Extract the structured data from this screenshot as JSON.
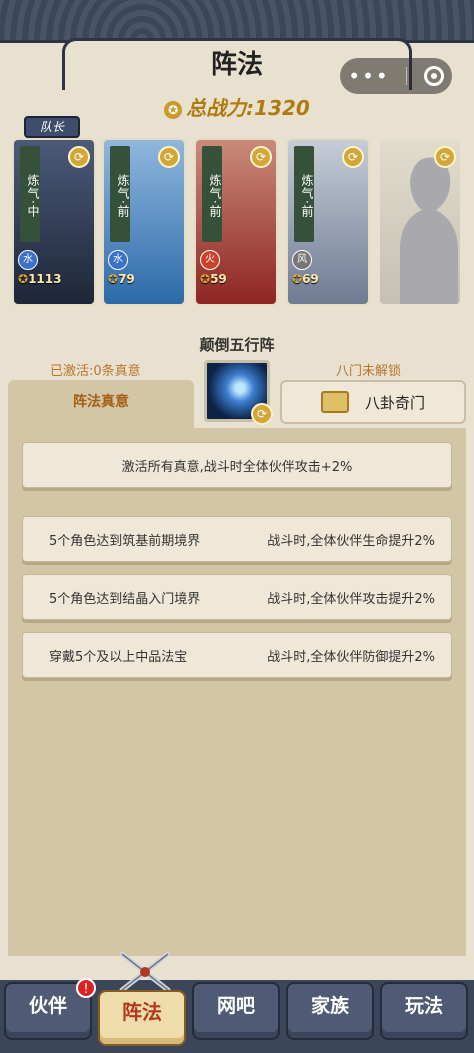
{
  "header": {
    "title": "阵法"
  },
  "total_power": {
    "label": "总战力:1320"
  },
  "captain_tag": "队长",
  "cards": [
    {
      "realm": "炼气·中",
      "element": "水",
      "element_color": "#3b72c8",
      "power": "1113",
      "bg": "#2e3a52"
    },
    {
      "realm": "炼气·前",
      "element": "水",
      "element_color": "#3b72c8",
      "power": "79",
      "bg": "#3a7bbf"
    },
    {
      "realm": "炼气·前",
      "element": "火",
      "element_color": "#c9432b",
      "power": "59",
      "bg": "#a9312e"
    },
    {
      "realm": "炼气·前",
      "element": "风",
      "element_color": "#777777",
      "power": "69",
      "bg": "#7f8aa0"
    },
    {
      "realm": "",
      "element": "",
      "element_color": "",
      "power": "",
      "bg": "#d4ccba",
      "locked": true
    }
  ],
  "formation": {
    "name": "颠倒五行阵",
    "activated_text": "已激活:0条真意",
    "bamen_text": "八门未解锁",
    "tab_label": "阵法真意",
    "bagua_label": "八卦奇门"
  },
  "effects": {
    "all": "激活所有真意,战斗时全体伙伴攻击+2%",
    "rows": [
      {
        "condition": "5个角色达到筑基前期境界",
        "effect": "战斗时,全体伙伴生命提升2%"
      },
      {
        "condition": "5个角色达到结晶入门境界",
        "effect": "战斗时,全体伙伴攻击提升2%"
      },
      {
        "condition": "穿戴5个及以上中品法宝",
        "effect": "战斗时,全体伙伴防御提升2%"
      }
    ]
  },
  "nav": {
    "partner": "伙伴",
    "formation": "阵法",
    "netbar": "网吧",
    "clan": "家族",
    "play": "玩法",
    "badge": "!"
  },
  "colors": {
    "panel": "#e9e1cf",
    "accent": "#b07a10",
    "nav": "#4f5b74"
  },
  "icons": [
    "menu-dots-icon",
    "close-ring-icon",
    "medal-icon",
    "swap-icon",
    "element-icon",
    "formation-icon",
    "book-icon",
    "swords-icon",
    "alert-icon"
  ]
}
